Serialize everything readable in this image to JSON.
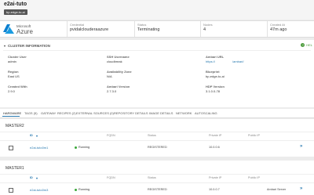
{
  "header": {
    "title": "e2ai-tuto",
    "tag": "bp-edge-to-ai"
  },
  "summary": {
    "brand_small": "Microsoft",
    "brand_large": "Azure",
    "credential_label": "Credential",
    "credential_value": "pvidalclouderaazure",
    "status_label": "Status",
    "status_value": "Terminating",
    "nodes_label": "Nodes",
    "nodes_value": "4",
    "created_label": "Created At",
    "created_value": "47m ago"
  },
  "info": {
    "title": "CLUSTER INFORMATION",
    "help": "HEL",
    "cluster_user_label": "Cluster User",
    "cluster_user_value": "admin",
    "ssh_label": "SSH Username",
    "ssh_value": "cloudbreak",
    "ambari_url_label": "Ambari URL",
    "ambari_url_value": "https://",
    "ambari_url_link": "/ambari/",
    "region_label": "Region",
    "region_value": "East US",
    "az_label": "Availability Zone",
    "az_value": "N/A",
    "blueprint_label": "Blueprint",
    "blueprint_value": "bp-edge-to-ai",
    "created_with_label": "Created With",
    "created_with_value": "2.9.0",
    "ambari_ver_label": "Ambari Version",
    "ambari_ver_value": "2.7.3.0",
    "hdp_label": "HDP Version",
    "hdp_value": "3.1.0.0-78"
  },
  "tabs": [
    "HARDWARE",
    "TAGS (5)",
    "GATEWAY",
    "RECIPES (2)",
    "EXTERNAL SOURCES (0)",
    "REPOSITORY DETAILS",
    "IMAGE DETAILS",
    "NETWORK",
    "AUTOSCALING"
  ],
  "columns": {
    "id": "ID",
    "fqdn": "FQDN",
    "status": "Status",
    "private_ip": "Private IP",
    "public_ip": "Public IP"
  },
  "groups": [
    {
      "name": "MASTER2",
      "vm": {
        "id": "e2ai-tuto0m1",
        "state": "Running",
        "status": "REGISTERED",
        "private_ip": "10.0.0.6",
        "extra": ""
      }
    },
    {
      "name": "MASTER1",
      "vm": {
        "id": "e2ai-tuto0m3",
        "state": "Running",
        "status": "REGISTERED",
        "private_ip": "10.0.0.7",
        "extra": "Ambari Server"
      }
    }
  ]
}
